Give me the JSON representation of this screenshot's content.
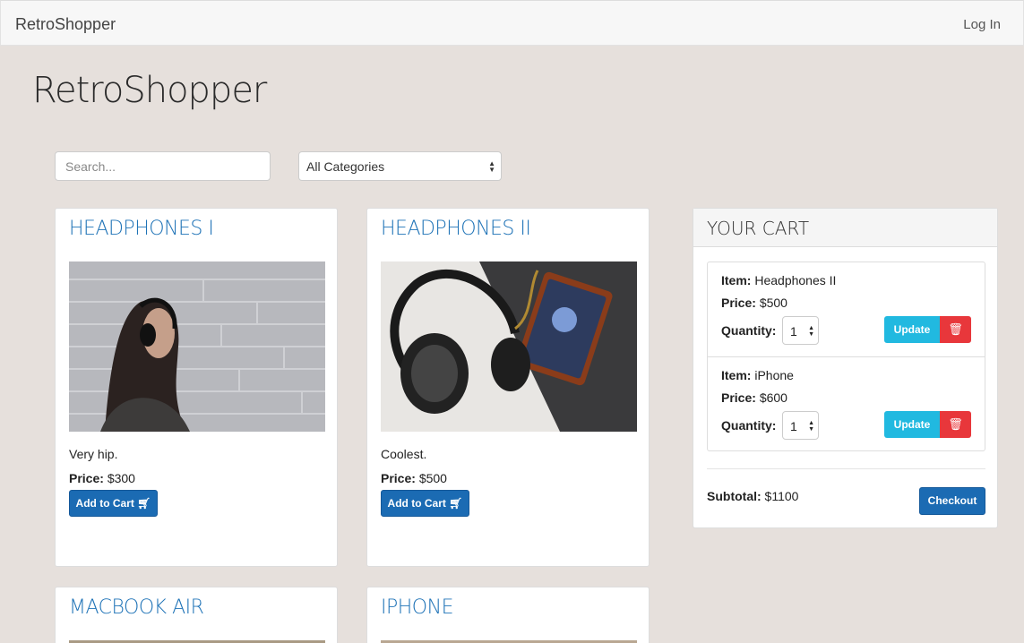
{
  "navbar": {
    "brand": "RetroShopper",
    "login": "Log In"
  },
  "header": {
    "title": "RetroShopper"
  },
  "filters": {
    "search_placeholder": "Search...",
    "category_selected": "All Categories"
  },
  "products": [
    {
      "title": "HEADPHONES I",
      "description": "Very hip.",
      "price_label": "Price:",
      "price": "$300",
      "button": "Add to Cart"
    },
    {
      "title": "HEADPHONES II",
      "description": "Coolest.",
      "price_label": "Price:",
      "price": "$500",
      "button": "Add to Cart"
    },
    {
      "title": "MACBOOK AIR"
    },
    {
      "title": "IPHONE"
    }
  ],
  "cart": {
    "title": "YOUR CART",
    "items": [
      {
        "item_label": "Item:",
        "name": "Headphones II",
        "price_label": "Price:",
        "price": "$500",
        "qty_label": "Quantity:",
        "qty": "1",
        "update": "Update"
      },
      {
        "item_label": "Item:",
        "name": "iPhone",
        "price_label": "Price:",
        "price": "$600",
        "qty_label": "Quantity:",
        "qty": "1",
        "update": "Update"
      }
    ],
    "subtotal_label": "Subtotal:",
    "subtotal": "$1100",
    "checkout": "Checkout"
  },
  "icons": {
    "cart": "cart-icon",
    "trash": "trash-icon",
    "select_arrows": "select-arrows-icon"
  }
}
